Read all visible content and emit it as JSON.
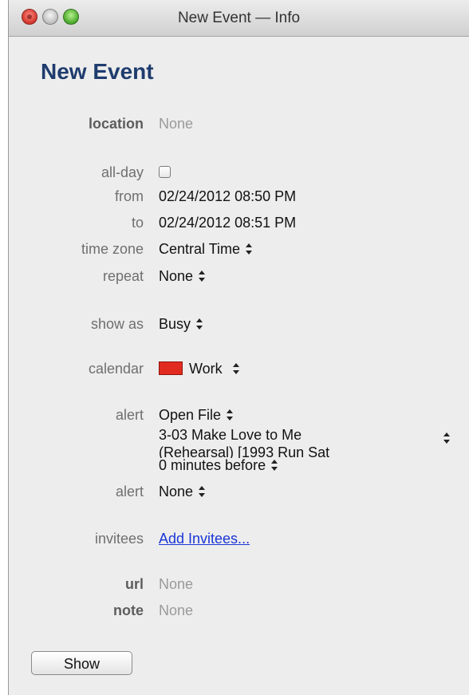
{
  "window": {
    "title": "New Event — Info"
  },
  "event": {
    "heading": "New Event",
    "location": {
      "label": "location",
      "value": "None"
    },
    "all_day": {
      "label": "all-day",
      "checked": false
    },
    "from": {
      "label": "from",
      "value": "02/24/2012 08:50 PM"
    },
    "to": {
      "label": "to",
      "value": "02/24/2012 08:51 PM"
    },
    "time_zone": {
      "label": "time zone",
      "value": "Central Time"
    },
    "repeat": {
      "label": "repeat",
      "value": "None"
    },
    "show_as": {
      "label": "show as",
      "value": "Busy"
    },
    "calendar": {
      "label": "calendar",
      "value": "Work",
      "color": "#e22b20"
    },
    "alert1": {
      "label": "alert",
      "action": "Open File",
      "file_line1": "3-03 Make Love to Me",
      "file_line2": "(Rehearsal) [1993 Run Sat",
      "timing": "0 minutes before"
    },
    "alert2": {
      "label": "alert",
      "value": "None"
    },
    "invitees": {
      "label": "invitees",
      "link": "Add Invitees..."
    },
    "url": {
      "label": "url",
      "value": "None"
    },
    "note": {
      "label": "note",
      "value": "None"
    }
  },
  "buttons": {
    "show": "Show"
  }
}
